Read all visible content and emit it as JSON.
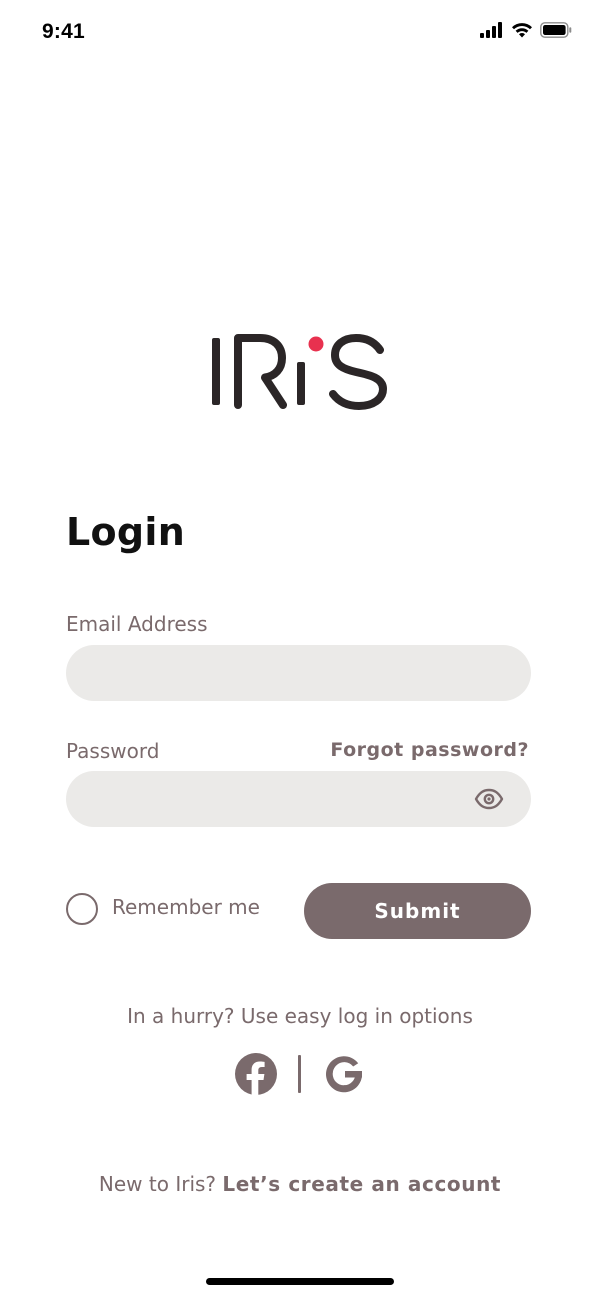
{
  "status_bar": {
    "time": "9:41",
    "icons": [
      "signal-bars-icon",
      "wifi-icon",
      "battery-icon"
    ]
  },
  "logo": {
    "text": "IRiS",
    "dot_color": "#e8314f",
    "text_color": "#2b2627"
  },
  "login": {
    "title": "Login",
    "email_label": "Email Address",
    "email_value": "",
    "email_placeholder": "",
    "password_label": "Password",
    "forgot_password": "Forgot password?",
    "password_value": "",
    "password_placeholder": "",
    "password_toggle_icon": "eye-icon",
    "remember_label": "Remember me",
    "remember_checked": false,
    "submit_label": "Submit"
  },
  "easy_login": {
    "text": "In a hurry? Use easy log in options",
    "providers": [
      {
        "icon": "facebook-icon"
      },
      {
        "icon": "google-icon"
      }
    ]
  },
  "signup": {
    "prompt": "New to Iris? ",
    "link": "Let’s create an account"
  },
  "colors": {
    "accent": "#7a6a6c",
    "input_bg": "#ebeae8",
    "logo_dot": "#e8314f"
  }
}
